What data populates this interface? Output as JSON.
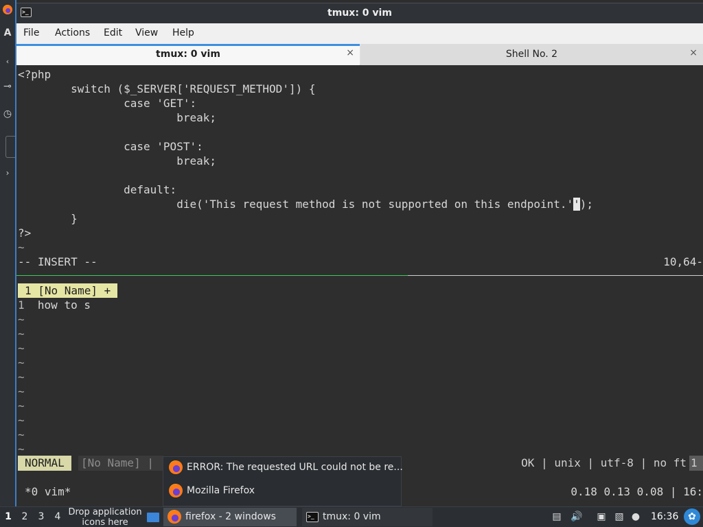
{
  "window": {
    "title": "tmux: 0 vim"
  },
  "menubar": {
    "items": [
      "File",
      "Actions",
      "Edit",
      "View",
      "Help"
    ]
  },
  "tabs": [
    {
      "label": "tmux: 0 vim",
      "close": "×"
    },
    {
      "label": "Shell No. 2",
      "close": "×"
    }
  ],
  "editor": {
    "code": [
      "<?php",
      "        switch ($_SERVER['REQUEST_METHOD']) {",
      "                case 'GET':",
      "                        break;",
      "",
      "                case 'POST':",
      "                        break;",
      "",
      "                default:",
      "                        die('This request method is not supported on this endpoint.'",
      "        }",
      "?>",
      "~"
    ],
    "cursor_char": "'",
    "after_cursor": ");",
    "mode": "-- INSERT --",
    "position": "10,64-"
  },
  "lower_pane": {
    "tabline": "1 [No Name] +",
    "line_number": "1",
    "line_text": "  how to s",
    "tilde": "~",
    "status_mode": "NORMAL",
    "status_buffer": "[No Name] |",
    "status_right": "OK | unix | utf-8 | no ft",
    "status_end": "1",
    "tmux_window": "*0 vim*",
    "load": "0.18 0.13 0.08 | 16:"
  },
  "popup": {
    "items": [
      "ERROR: The requested URL could not be re...",
      "Mozilla Firefox"
    ]
  },
  "taskbar": {
    "workspaces": [
      "1",
      "2",
      "3",
      "4"
    ],
    "drop_hint": "Drop application icons here",
    "tasks": [
      "firefox - 2 windows",
      "tmux: 0 vim"
    ],
    "clock": "16:36"
  },
  "colors": {
    "accent": "#3d8ee0",
    "split_active": "#3ec95c",
    "vim_tabline": "#e6e6a4"
  },
  "icons": [
    "terminal-icon",
    "firefox-icon",
    "close-icon",
    "show-desktop-icon",
    "volume-icon",
    "network-icon",
    "clipboard-icon",
    "notification-icon",
    "start-menu-icon"
  ]
}
